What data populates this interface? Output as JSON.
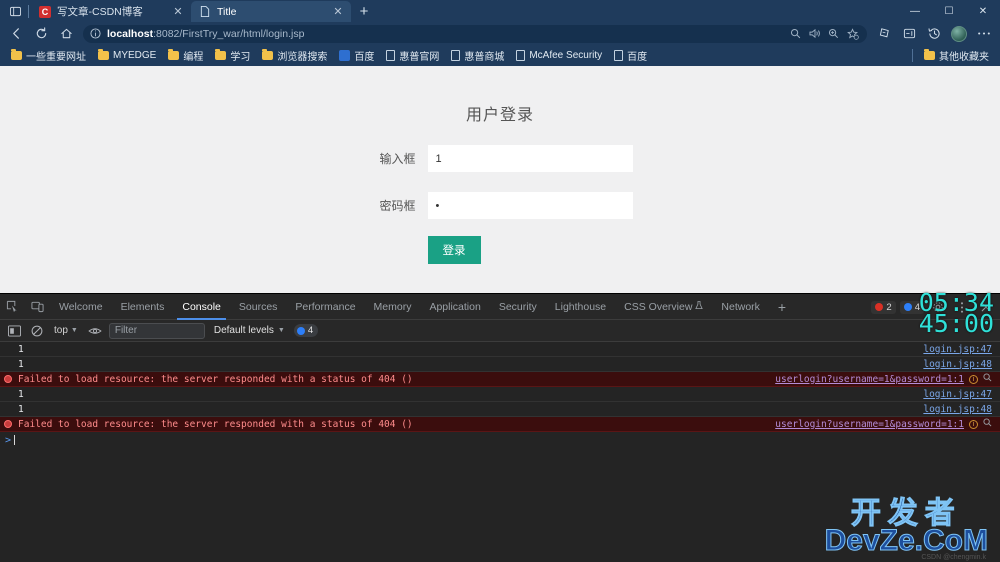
{
  "browser": {
    "tabs": [
      {
        "title": "写文章-CSDN博客",
        "favicon": "csdn-icon",
        "active": false,
        "close_label": "✕"
      },
      {
        "title": "Title",
        "favicon": "page-icon",
        "active": true,
        "close_label": "✕"
      }
    ],
    "new_tab_label": "+",
    "tab_search_icon": "tab-search-icon",
    "window_controls": {
      "minimize": "—",
      "maximize": "☐",
      "close": "✕"
    },
    "nav": {
      "back": "←",
      "forward_disabled": true,
      "refresh": "⟳",
      "home": "⌂",
      "url_prefix": "localhost",
      "url_rest": ":8082/FirstTry_war/html/login.jsp",
      "info_icon": "info-circle-icon",
      "omnibox_icons": [
        "search-icon",
        "read-aloud-icon",
        "zoom-icon",
        "favorite-icon"
      ],
      "right_icons": [
        "collections-icon",
        "browser-essentials-icon",
        "history-icon",
        "profile-avatar",
        "settings-more-icon"
      ]
    },
    "bookmarks": [
      {
        "label": "一些重要网址",
        "icon": "folder-icon"
      },
      {
        "label": "MYEDGE",
        "icon": "folder-icon"
      },
      {
        "label": "编程",
        "icon": "folder-icon"
      },
      {
        "label": "学习",
        "icon": "folder-icon"
      },
      {
        "label": "浏览器搜索",
        "icon": "folder-icon"
      },
      {
        "label": "百度",
        "icon": "baidu-icon"
      },
      {
        "label": "惠普官网",
        "icon": "page-icon"
      },
      {
        "label": "惠普商城",
        "icon": "page-icon"
      },
      {
        "label": "McAfee Security",
        "icon": "page-icon"
      },
      {
        "label": "百度",
        "icon": "page-icon"
      }
    ],
    "other_favorites": {
      "label": "其他收藏夹",
      "icon": "folder-icon"
    }
  },
  "page": {
    "title": "用户登录",
    "fields": [
      {
        "label": "输入框",
        "value": "1",
        "type": "text"
      },
      {
        "label": "密码框",
        "value": "•",
        "type": "password"
      }
    ],
    "submit_label": "登录",
    "accent_color": "#1aa185",
    "background_color": "#f0f0f1"
  },
  "devtools": {
    "left_icons": [
      "inspect-element-icon",
      "device-toolbar-icon"
    ],
    "tabs": [
      {
        "label": "Welcome",
        "active": false
      },
      {
        "label": "Elements",
        "active": false
      },
      {
        "label": "Console",
        "active": true
      },
      {
        "label": "Sources",
        "active": false
      },
      {
        "label": "Performance",
        "active": false
      },
      {
        "label": "Memory",
        "active": false
      },
      {
        "label": "Application",
        "active": false
      },
      {
        "label": "Security",
        "active": false
      },
      {
        "label": "Lighthouse",
        "active": false
      },
      {
        "label": "CSS Overview",
        "active": false,
        "suffix_icon": "beaker-icon"
      },
      {
        "label": "Network",
        "active": false
      }
    ],
    "add_tab_label": "+",
    "error_count": "2",
    "info_count": "4",
    "settings_icon": "gear-icon",
    "more_icon": "more-vertical-icon",
    "close_icon": "close-icon",
    "console_toolbar": {
      "sidebar_icon": "console-sidebar-icon",
      "clear_icon": "clear-console-icon",
      "context": "top",
      "eye_icon": "live-expression-icon",
      "filter_placeholder": "Filter",
      "filter_value": "",
      "levels": "Default levels",
      "info_badge_count": "4"
    },
    "console_rows": [
      {
        "kind": "log",
        "message": "1",
        "source": "login.jsp:47"
      },
      {
        "kind": "log",
        "message": "1",
        "source": "login.jsp:48"
      },
      {
        "kind": "error",
        "message": "Failed to load resource: the server responded with a status of 404 ()",
        "source": "userlogin?username=1&password=1:1",
        "info_icon": "info-circle-icon",
        "search_icon": "search-icon"
      },
      {
        "kind": "log",
        "message": "1",
        "source": "login.jsp:47"
      },
      {
        "kind": "log",
        "message": "1",
        "source": "login.jsp:48"
      },
      {
        "kind": "error",
        "message": "Failed to load resource: the server responded with a status of 404 ()",
        "source": "userlogin?username=1&password=1:1",
        "info_icon": "info-circle-icon",
        "search_icon": "search-icon"
      }
    ],
    "prompt_symbol": ">"
  },
  "overlays": {
    "clock_line1": "05:34",
    "clock_line2": "45:00",
    "clock_color": "#2fe0d8",
    "watermark_cn": "开发者",
    "watermark_en": "DevZe.CoM",
    "watermark_sub": "CSDN @chengmin.k"
  }
}
